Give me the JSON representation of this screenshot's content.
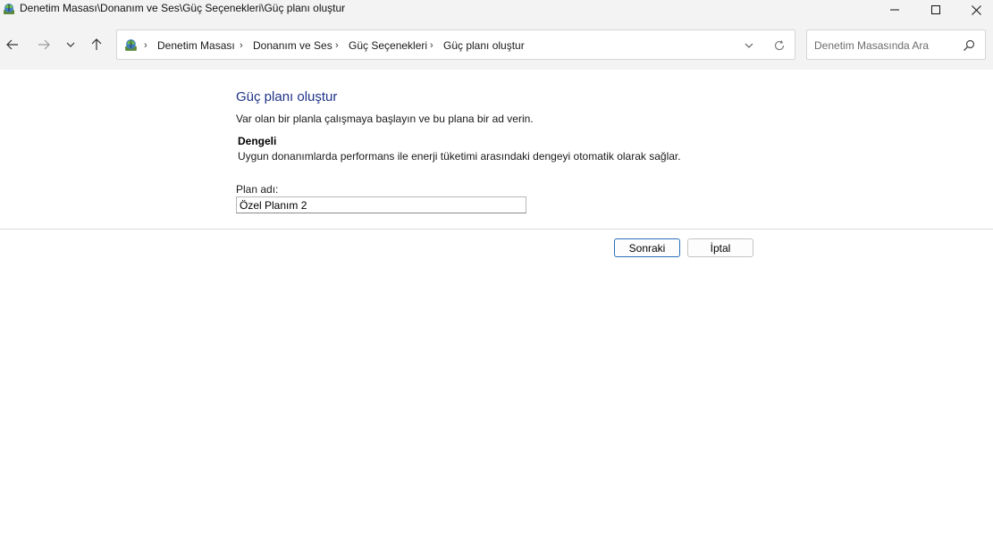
{
  "window": {
    "title": "Denetim Masası\\Donanım ve Ses\\Güç Seçenekleri\\Güç planı oluştur",
    "icon": "control-panel-icon"
  },
  "navigation": {
    "breadcrumbs": [
      "Denetim Masası",
      "Donanım ve Ses",
      "Güç Seçenekleri",
      "Güç planı oluştur"
    ]
  },
  "search": {
    "placeholder": "Denetim Masasında Ara"
  },
  "main": {
    "heading": "Güç planı oluştur",
    "intro": "Var olan bir planla çalışmaya başlayın ve bu plana bir ad verin.",
    "plan": {
      "name": "Dengeli",
      "description": "Uygun donanımlarda performans ile enerji tüketimi arasındaki dengeyi otomatik olarak sağlar."
    },
    "plan_name_label": "Plan adı:",
    "plan_name_value": "Özel Planım 2"
  },
  "buttons": {
    "next": "Sonraki",
    "cancel": "İptal"
  },
  "colors": {
    "heading": "#1e3287",
    "primary_button_border": "#2a6fb8",
    "chrome_background": "#f3f3f3"
  }
}
